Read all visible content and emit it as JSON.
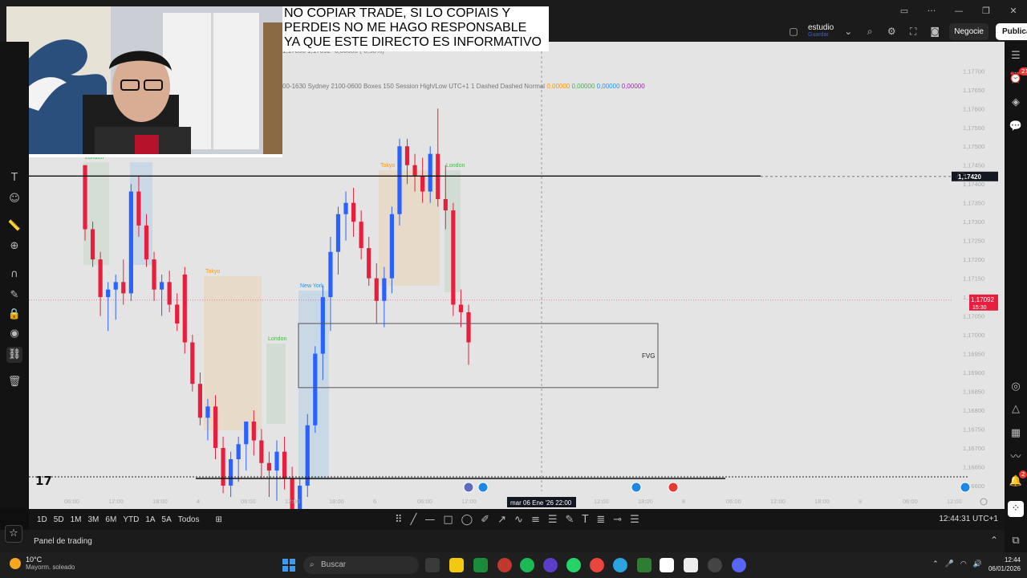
{
  "disclaimer": {
    "lines": [
      "NO COPIAR TRADE, SI LO COPIAIS Y",
      "PERDEIS NO ME HAGO RESPONSABLE",
      "YA QUE ESTE DIRECTO ES INFORMATIVO"
    ]
  },
  "header": {
    "layout_name": "estudio",
    "layout_status": "Guardar",
    "trade_button": "Negocie",
    "publish_button": "Publicar",
    "ohlc_fragment": "1,17850  1,17092  -0,00685 (-0,58%)"
  },
  "indicator": {
    "settings_text": "00-1630 Sydney 2100-0600 Boxes 150 Session High/Low UTC+1 1 Dashed Dashed Normal",
    "values": [
      {
        "text": "0,00000",
        "color": "#ff9800"
      },
      {
        "text": "0,00000",
        "color": "#4caf50"
      },
      {
        "text": "0,00000",
        "color": "#2196f3"
      },
      {
        "text": "0,00000",
        "color": "#9c27b0"
      }
    ]
  },
  "chart_data": {
    "type": "candlestick",
    "instrument_hint": "EURUSD",
    "y_axis_ticks": [
      "1,17700",
      "1,17650",
      "1,17600",
      "1,17550",
      "1,17500",
      "1,17450",
      "1,17400",
      "1,17350",
      "1,17300",
      "1,17250",
      "1,17200",
      "1,17150",
      "1,17100",
      "1,17050",
      "1,17000",
      "1,16950",
      "1,16900",
      "1,16850",
      "1,16800",
      "1,16750",
      "1,16700",
      "1,16650",
      "1,16600"
    ],
    "x_axis_ticks": [
      "06:00",
      "12:00",
      "18:00",
      "4",
      "06:00",
      "12:00",
      "18:00",
      "6",
      "06:00",
      "12:00",
      "18:00",
      "06:00",
      "12:00",
      "18:00",
      "8",
      "06:00",
      "12:00",
      "18:00",
      "9",
      "06:00",
      "12:00"
    ],
    "crosshair_price": "1,17420",
    "crosshair_time": "mar 06 Ene '26  22:00",
    "last_price": "1,17092",
    "last_price_countdown": "15:30",
    "fvg_label": "FVG",
    "fvg_zone": [
      1.1686,
      1.1703
    ],
    "session_labels": [
      "London",
      "Tokyo",
      "London",
      "New York",
      "Tokyo",
      "London"
    ],
    "candles": [
      [
        1.1745,
        1.1745,
        1.1725,
        1.1728
      ],
      [
        1.1728,
        1.173,
        1.1718,
        1.172
      ],
      [
        1.172,
        1.1722,
        1.1705,
        1.171
      ],
      [
        1.171,
        1.1714,
        1.1701,
        1.1712
      ],
      [
        1.1712,
        1.1716,
        1.1704,
        1.1714
      ],
      [
        1.1714,
        1.172,
        1.1708,
        1.1711
      ],
      [
        1.1711,
        1.174,
        1.1709,
        1.1738
      ],
      [
        1.1738,
        1.1742,
        1.1726,
        1.1729
      ],
      [
        1.1729,
        1.1732,
        1.1718,
        1.172
      ],
      [
        1.172,
        1.1722,
        1.1709,
        1.1712
      ],
      [
        1.1712,
        1.1716,
        1.1705,
        1.1714
      ],
      [
        1.1714,
        1.1717,
        1.1706,
        1.1708
      ],
      [
        1.1708,
        1.1711,
        1.1701,
        1.1703
      ],
      [
        1.1716,
        1.1718,
        1.1695,
        1.1698
      ],
      [
        1.1698,
        1.17,
        1.1685,
        1.1687
      ],
      [
        1.1687,
        1.169,
        1.1676,
        1.1678
      ],
      [
        1.1678,
        1.1683,
        1.1672,
        1.1681
      ],
      [
        1.1681,
        1.1684,
        1.1667,
        1.167
      ],
      [
        1.167,
        1.1673,
        1.1658,
        1.166
      ],
      [
        1.166,
        1.1669,
        1.1657,
        1.1667
      ],
      [
        1.1667,
        1.1673,
        1.1661,
        1.1671
      ],
      [
        1.1671,
        1.1676,
        1.1664,
        1.1677
      ],
      [
        1.1677,
        1.168,
        1.1668,
        1.1672
      ],
      [
        1.1672,
        1.1675,
        1.1662,
        1.1666
      ],
      [
        1.1666,
        1.1669,
        1.1657,
        1.1664
      ],
      [
        1.1664,
        1.1672,
        1.1656,
        1.1669
      ],
      [
        1.1669,
        1.1673,
        1.1659,
        1.1662
      ],
      [
        1.1662,
        1.1665,
        1.1649,
        1.1652
      ],
      [
        1.1652,
        1.1662,
        1.1639,
        1.166
      ],
      [
        1.166,
        1.1679,
        1.1657,
        1.1676
      ],
      [
        1.1676,
        1.1697,
        1.1674,
        1.1695
      ],
      [
        1.1695,
        1.1713,
        1.1688,
        1.171
      ],
      [
        1.171,
        1.1726,
        1.1701,
        1.1722
      ],
      [
        1.1722,
        1.1734,
        1.1716,
        1.1732
      ],
      [
        1.1732,
        1.1738,
        1.1725,
        1.1735
      ],
      [
        1.1735,
        1.1739,
        1.1726,
        1.173
      ],
      [
        1.173,
        1.1733,
        1.172,
        1.1723
      ],
      [
        1.1723,
        1.1726,
        1.1713,
        1.1715
      ],
      [
        1.1715,
        1.1719,
        1.1703,
        1.1709
      ],
      [
        1.1709,
        1.1718,
        1.1702,
        1.1715
      ],
      [
        1.1715,
        1.1734,
        1.1711,
        1.1732
      ],
      [
        1.1732,
        1.1752,
        1.1729,
        1.175
      ],
      [
        1.175,
        1.1752,
        1.174,
        1.1745
      ],
      [
        1.1745,
        1.1748,
        1.1738,
        1.1742
      ],
      [
        1.1742,
        1.1747,
        1.1735,
        1.1738
      ],
      [
        1.1738,
        1.175,
        1.1735,
        1.1748
      ],
      [
        1.1748,
        1.176,
        1.1734,
        1.1736
      ],
      [
        1.1736,
        1.1745,
        1.1728,
        1.1733
      ],
      [
        1.1733,
        1.1735,
        1.1705,
        1.1708
      ],
      [
        1.1708,
        1.1712,
        1.1702,
        1.1706
      ],
      [
        1.1706,
        1.1708,
        1.1692,
        1.1698
      ]
    ]
  },
  "timeframes": [
    "1D",
    "5D",
    "1M",
    "3M",
    "6M",
    "YTD",
    "1A",
    "5A",
    "Todos"
  ],
  "clock": "12:44:31 UTC+1",
  "panel_label": "Panel de trading",
  "taskbar": {
    "weather_temp": "10°C",
    "weather_desc": "Mayorm. soleado",
    "search_placeholder": "Buscar",
    "time": "12:44",
    "date": "06/01/2026"
  },
  "badges": {
    "alerts": "21",
    "notifications": "2"
  }
}
